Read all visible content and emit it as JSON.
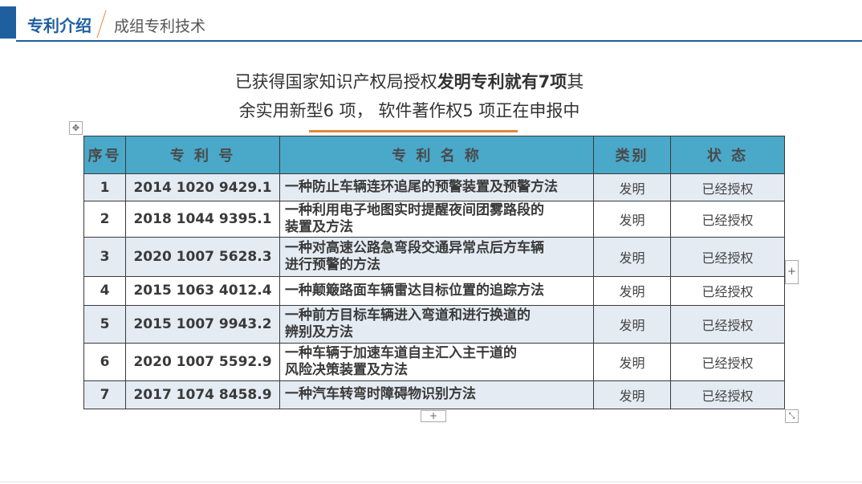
{
  "header": {
    "title": "专利介绍",
    "subtitle": "成组专利技术"
  },
  "intro": {
    "line1_pre": "已获得国家知识产权局授权",
    "line1_bold": "发明专利就有7项",
    "line1_post": "其",
    "line2": "余实用新型6 项， 软件著作权5 项正在申报中"
  },
  "controls": {
    "move_glyph": "✥",
    "add_col_glyph": "+",
    "add_row_glyph": "+",
    "resize_glyph": "⤡"
  },
  "table": {
    "headers": [
      "序号",
      "专 利 号",
      "专 利 名 称",
      "类别",
      "状 态"
    ],
    "rows": [
      {
        "seq": "1",
        "no": "2014 1020 9429.1",
        "name": "一种防止车辆连环追尾的预警装置及预警方法",
        "type": "发明",
        "status": "已经授权"
      },
      {
        "seq": "2",
        "no": "2018 1044 9395.1",
        "name": "一种利用电子地图实时提醒夜间团雾路段的\n装置及方法",
        "type": "发明",
        "status": "已经授权"
      },
      {
        "seq": "3",
        "no": "2020 1007 5628.3",
        "name": "一种对高速公路急弯段交通异常点后方车辆\n进行预警的方法",
        "type": "发明",
        "status": "已经授权"
      },
      {
        "seq": "4",
        "no": "2015 1063 4012.4",
        "name": "一种颠簸路面车辆雷达目标位置的追踪方法",
        "type": "发明",
        "status": "已经授权"
      },
      {
        "seq": "5",
        "no": "2015 1007 9943.2",
        "name": "一种前方目标车辆进入弯道和进行换道的\n辨别及方法",
        "type": "发明",
        "status": "已经授权"
      },
      {
        "seq": "6",
        "no": "2020 1007 5592.9",
        "name": "一种车辆于加速车道自主汇入主干道的\n风险决策装置及方法",
        "type": "发明",
        "status": "已经授权"
      },
      {
        "seq": "7",
        "no": "2017 1074 8458.9",
        "name": "一种汽车转弯时障碍物识别方法",
        "type": "发明",
        "status": "已经授权"
      }
    ]
  },
  "colors": {
    "brand_blue": "#1f5fa0",
    "accent_orange": "#e08a3c",
    "table_header": "#4aa8c9",
    "row_alt": "#e4ebf3"
  }
}
